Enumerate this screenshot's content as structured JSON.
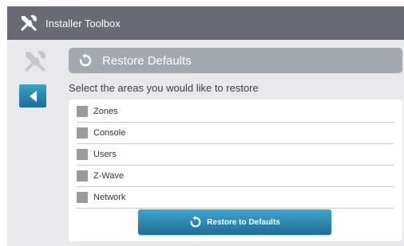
{
  "header": {
    "title": "Installer Toolbox",
    "icon": "tools-icon"
  },
  "sidebar": {
    "back_icon": "back-arrow-icon"
  },
  "section": {
    "title": "Restore Defaults",
    "icon": "restore-icon"
  },
  "instructions": "Select the areas you would like to restore",
  "areas": [
    {
      "label": "Zones",
      "checked": false
    },
    {
      "label": "Console",
      "checked": false
    },
    {
      "label": "Users",
      "checked": false
    },
    {
      "label": "Z-Wave",
      "checked": false
    },
    {
      "label": "Network",
      "checked": false
    }
  ],
  "restore_button": {
    "label": "Restore to Defaults",
    "icon": "restore-icon"
  },
  "colors": {
    "header_bg": "#686b74",
    "content_bg": "#e9e9ec",
    "section_bar": "#a4a8af",
    "accent": "#2a86b0"
  }
}
